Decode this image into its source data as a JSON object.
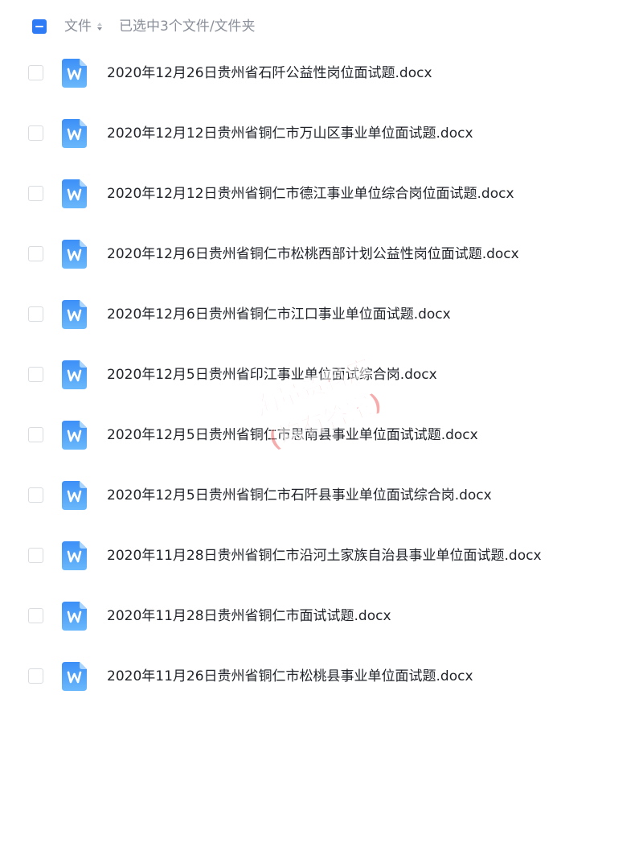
{
  "header": {
    "column_label": "文件",
    "selected_text": "已选中3个文件/文件夹",
    "sort_icon": "sort-caret-icon",
    "select_all_state": "indeterminate"
  },
  "accent_color": "#2f7bf5",
  "file_icon": "word-document-icon",
  "files": [
    {
      "name": "2020年12月26日贵州省石阡公益性岗位面试题.docx",
      "checked": false
    },
    {
      "name": "2020年12月12日贵州省铜仁市万山区事业单位面试题.docx",
      "checked": false
    },
    {
      "name": "2020年12月12日贵州省铜仁市德江事业单位综合岗位面试题.docx",
      "checked": false
    },
    {
      "name": "2020年12月6日贵州省铜仁市松桃西部计划公益性岗位面试题.docx",
      "checked": false
    },
    {
      "name": "2020年12月6日贵州省铜仁市江口事业单位面试题.docx",
      "checked": false
    },
    {
      "name": "2020年12月5日贵州省印江事业单位面试综合岗.docx",
      "checked": false
    },
    {
      "name": "2020年12月5日贵州省铜仁市思南县事业单位面试试题.docx",
      "checked": false
    },
    {
      "name": "2020年12月5日贵州省铜仁市石阡县事业单位面试综合岗.docx",
      "checked": false
    },
    {
      "name": "2020年11月28日贵州省铜仁市沿河土家族自治县事业单位面试题.docx",
      "checked": false
    },
    {
      "name": "2020年11月28日贵州省铜仁市面试试题.docx",
      "checked": false
    },
    {
      "name": "2020年11月26日贵州省铜仁市松桃县事业单位面试题.docx",
      "checked": false
    }
  ],
  "watermark": {
    "line1": "海量资料库",
    "line2": "(均有答案)"
  }
}
